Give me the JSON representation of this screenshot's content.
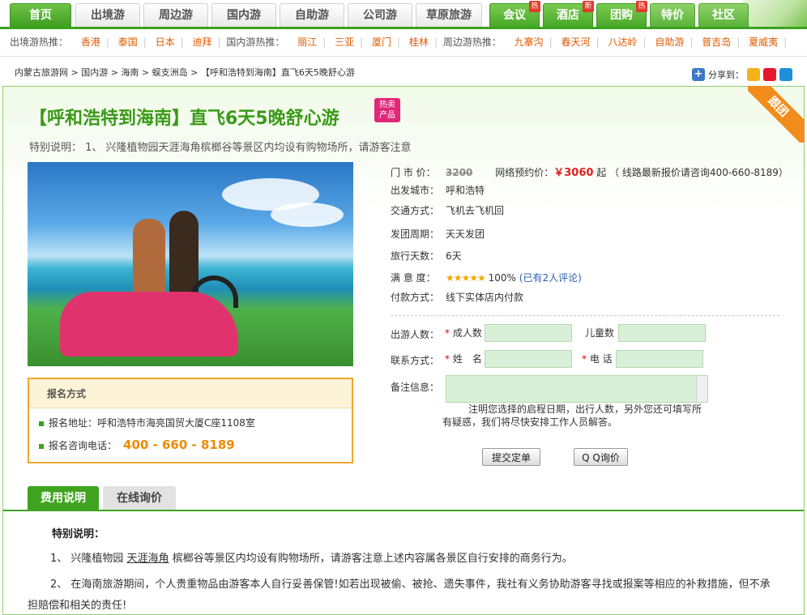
{
  "nav": {
    "tabs": [
      {
        "label": "首页",
        "left": 0
      },
      {
        "label": "出境游"
      },
      {
        "label": "周边游"
      },
      {
        "label": "国内游"
      },
      {
        "label": "自助游"
      },
      {
        "label": "公司游"
      },
      {
        "label": "草原旅游"
      },
      {
        "label": "会议",
        "flag": "热"
      },
      {
        "label": "酒店",
        "flag": "新"
      },
      {
        "label": "团购",
        "flag": "热"
      },
      {
        "label": "特价"
      },
      {
        "label": "社区"
      }
    ]
  },
  "hotbar": {
    "outbound_label": "出境游热推：",
    "outbound": [
      "香港",
      "泰国",
      "日本",
      "迪拜"
    ],
    "domestic_label": "国内游热推：",
    "domestic": [
      "丽江",
      "三亚",
      "厦门",
      "桂林"
    ],
    "nearby_label": "周边游热推：",
    "nearby": [
      "九寨沟",
      "春天河",
      "八达岭",
      "自助游",
      "普吉岛",
      "夏威夷"
    ]
  },
  "breadcrumb": "内蒙古旅游网 > 国内游 > 海南 > 蜈支洲岛 > 【呼和浩特到海南】直飞6天5晚舒心游",
  "share": {
    "label": "分享到："
  },
  "corner_label": "跟团",
  "product": {
    "title": "【呼和浩特到海南】直飞6天5晚舒心游",
    "badge_line1": "热卖",
    "badge_line2": "产品",
    "special_note": "特别说明：  1、 兴隆植物园天涯海角槟榔谷等景区内均设有购物场所，请游客注意"
  },
  "signup": {
    "title": "报名方式",
    "address": "报名地址：呼和浩特市海亮国贸大厦C座1108室",
    "phone_label": "报名咨询电话：",
    "phone": "400 - 660 - 8189"
  },
  "info": {
    "market_price_label": "门 市 价：",
    "market_price": "3200",
    "online_price_label": "网络预约价：",
    "online_price": "￥3060",
    "online_price_suffix": "起",
    "latest_price_note": "（ 线路最新报价请咨询400-660-8189）",
    "depart_city_label": "出发城市：",
    "depart_city": "呼和浩特",
    "transport_label": "交通方式：",
    "transport": "飞机去飞机回",
    "schedule_label": "发团周期：",
    "schedule": "天天发团",
    "days_label": "旅行天数：",
    "days": "6天",
    "satisfaction_label": "满 意 度：",
    "stars": "★★★★★",
    "satisfaction": "100%",
    "reviews": "(已有2人评论)",
    "payment_label": "付款方式：",
    "payment": "线下实体店内付款"
  },
  "form": {
    "people_label": "出游人数：",
    "adults_label": "成人数",
    "children_label": "儿童数",
    "contact_label": "联系方式：",
    "name_label": "姓　名",
    "phone_label": "电 话",
    "notes_label": "备注信息：",
    "required_mark": "*",
    "hint": "注明您选择的启程日期，出行人数，另外您还可填写所有疑惑，我们将尽快安排工作人员解答。",
    "submit": "提交定单",
    "qq": "Q Q询价"
  },
  "bottom_tabs": {
    "fees": "费用说明",
    "inquiry": "在线询价"
  },
  "details": {
    "section_title": "特别说明：",
    "p1_a": "1、 兴隆植物园 ",
    "p1_link": "天涯海角",
    "p1_b": " 槟榔谷等景区内均设有购物场所，请游客注意上述内容属各景区自行安排的商务行为。",
    "p2": "2、 在海南旅游期间，个人贵重物品由游客本人自行妥善保管!如若出现被偷、被抢、遗失事件，我社有义务协助游客寻找或报案等相应的补救措施，但不承担赔偿和相关的责任!"
  }
}
